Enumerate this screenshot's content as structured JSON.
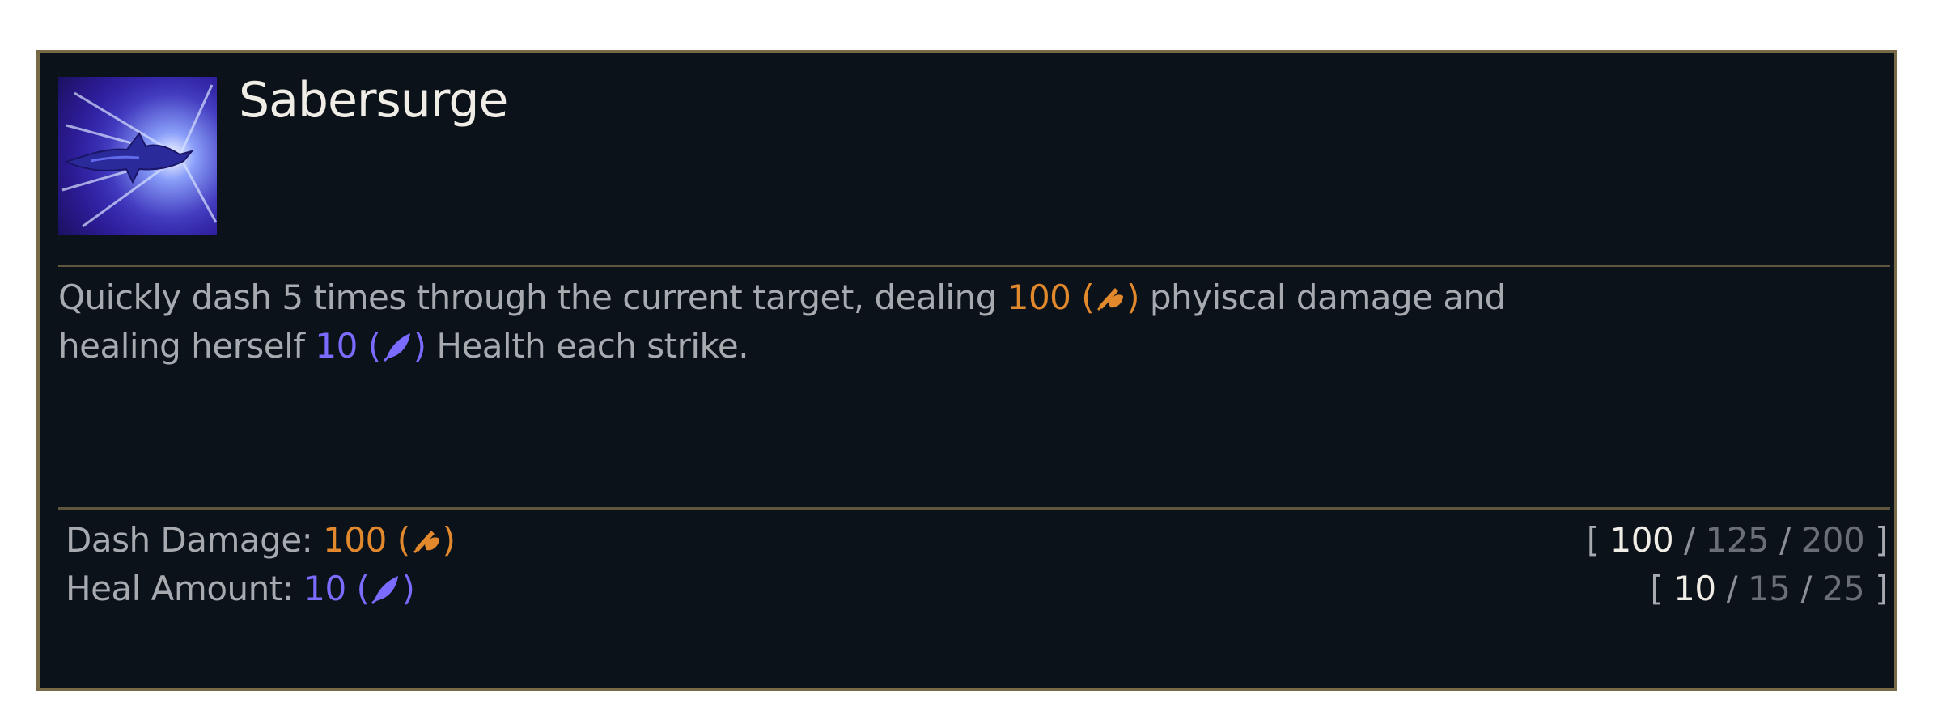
{
  "ability": {
    "name": "Sabersurge",
    "icon": "dashing-figure-ability-icon"
  },
  "description": {
    "part1": "Quickly dash 5 times through the current target, dealing ",
    "dmg_value": "100",
    "dmg_open": " (",
    "dmg_close": ")",
    "part2": " phyiscal damage and healing herself ",
    "heal_value": "10",
    "heal_open": " (",
    "heal_close": ")",
    "part3": " Health each strike."
  },
  "stats": [
    {
      "label": "Dash Damage: ",
      "value": "100",
      "open": " (",
      "close": ")",
      "scaling_icon": "attack-damage-icon",
      "ranks": [
        "100",
        "125",
        "200"
      ]
    },
    {
      "label": "Heal Amount: ",
      "value": "10",
      "open": " (",
      "close": ")",
      "scaling_icon": "ability-power-icon",
      "ranks": [
        "10",
        "15",
        "25"
      ]
    }
  ],
  "bracket_open": "[ ",
  "bracket_close": " ]",
  "rank_separator": " / ",
  "colors": {
    "physical": "#e2882d",
    "magic": "#7b6bff",
    "border": "#786a47",
    "background": "#0b121a"
  }
}
